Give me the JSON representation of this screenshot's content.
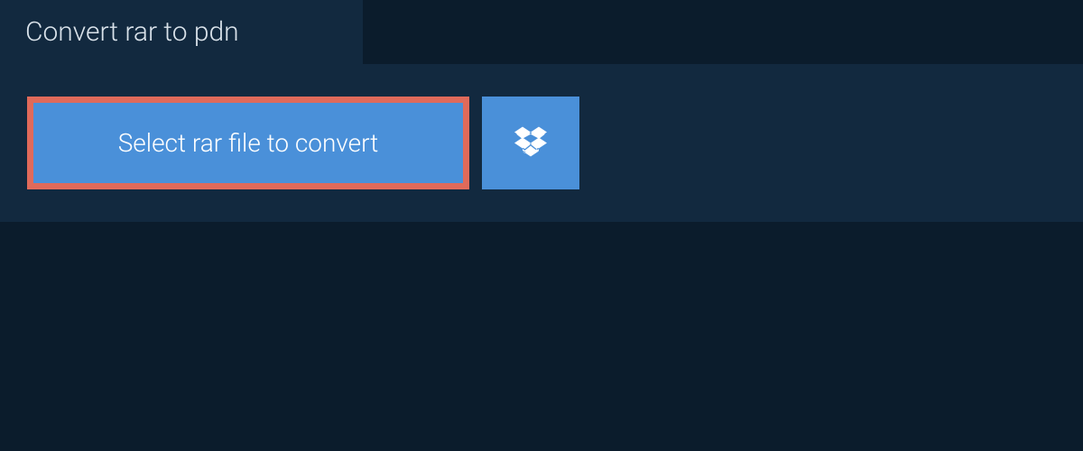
{
  "tab": {
    "label": "Convert rar to pdn"
  },
  "actions": {
    "select_file_label": "Select rar file to convert"
  },
  "colors": {
    "background": "#0b1c2c",
    "panel": "#12293f",
    "button": "#4a90d9",
    "button_border": "#e06a5a",
    "text_light": "#d9e2ea",
    "text_white": "#ffffff"
  }
}
